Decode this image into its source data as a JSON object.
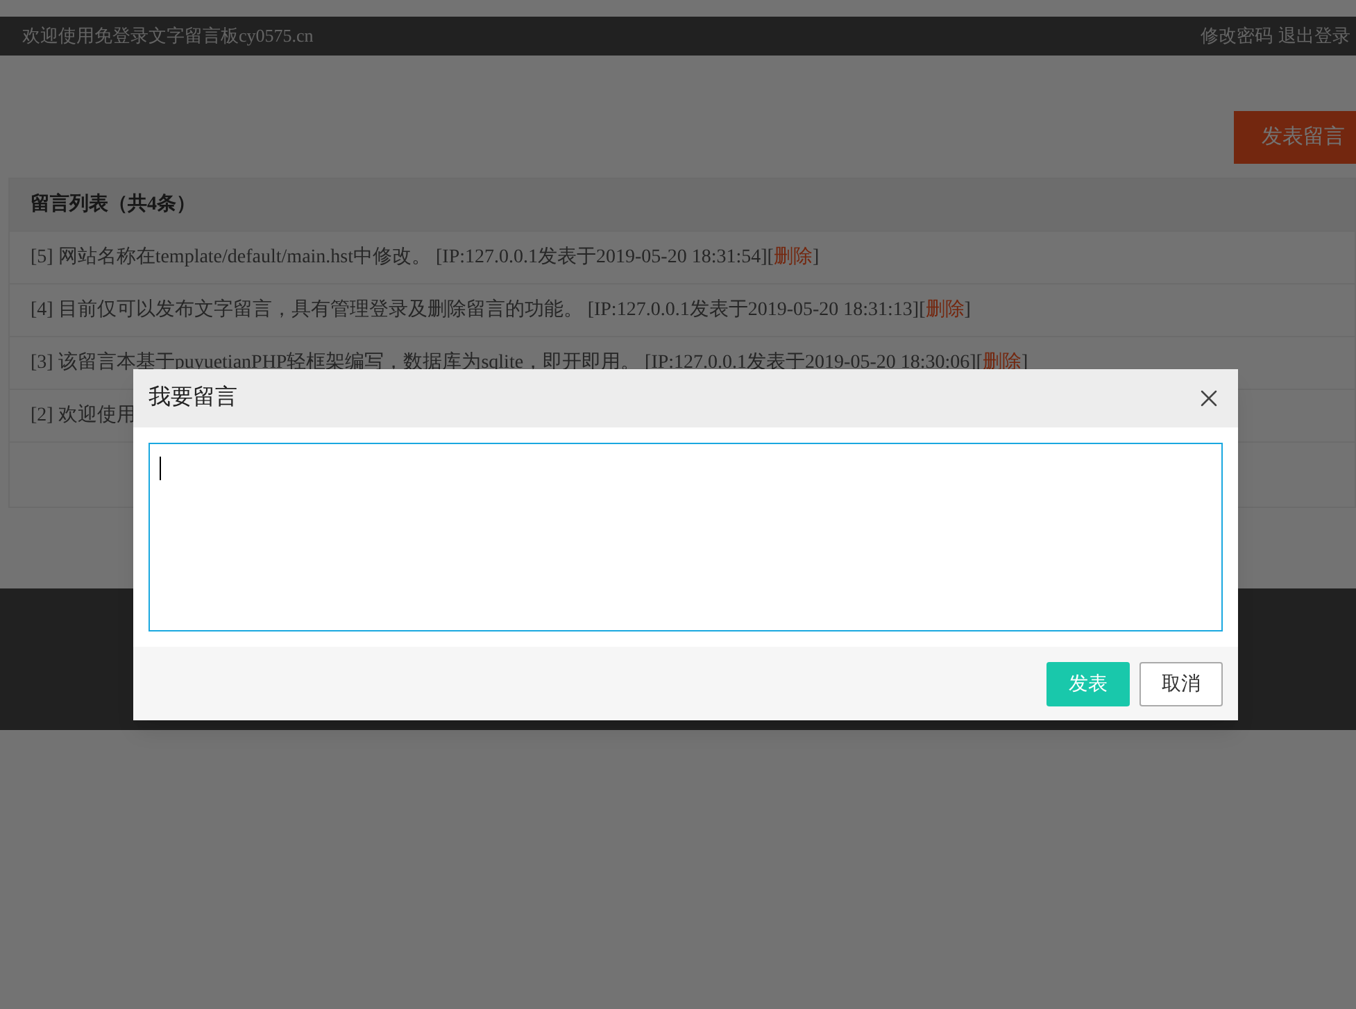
{
  "header": {
    "title": "欢迎使用免登录文字留言板cy0575.cn",
    "links": [
      "修改密码",
      "退出登录"
    ]
  },
  "post_button": "发表留言",
  "list": {
    "title": "留言列表（共4条）",
    "messages": [
      {
        "text": "[5] 网站名称在template/default/main.hst中修改。 [IP:127.0.0.1发表于2019-05-20 18:31:54][",
        "delete": "删除",
        "suffix": "]"
      },
      {
        "text": "[4] 目前仅可以发布文字留言，具有管理登录及删除留言的功能。 [IP:127.0.0.1发表于2019-05-20 18:31:13][",
        "delete": "删除",
        "suffix": "]"
      },
      {
        "text": "[3] 该留言本基于puyuetianPHP轻框架编写，数据库为sqlite，即开即用。 [IP:127.0.0.1发表于2019-05-20 18:30:06][",
        "delete": "删除",
        "suffix": "]"
      },
      {
        "text": "[2] 欢迎使用"
      }
    ]
  },
  "dialog": {
    "title": "我要留言",
    "buttons": [
      {
        "label": "发表",
        "kind": "primary"
      },
      {
        "label": "取消",
        "kind": "secondary"
      }
    ]
  }
}
